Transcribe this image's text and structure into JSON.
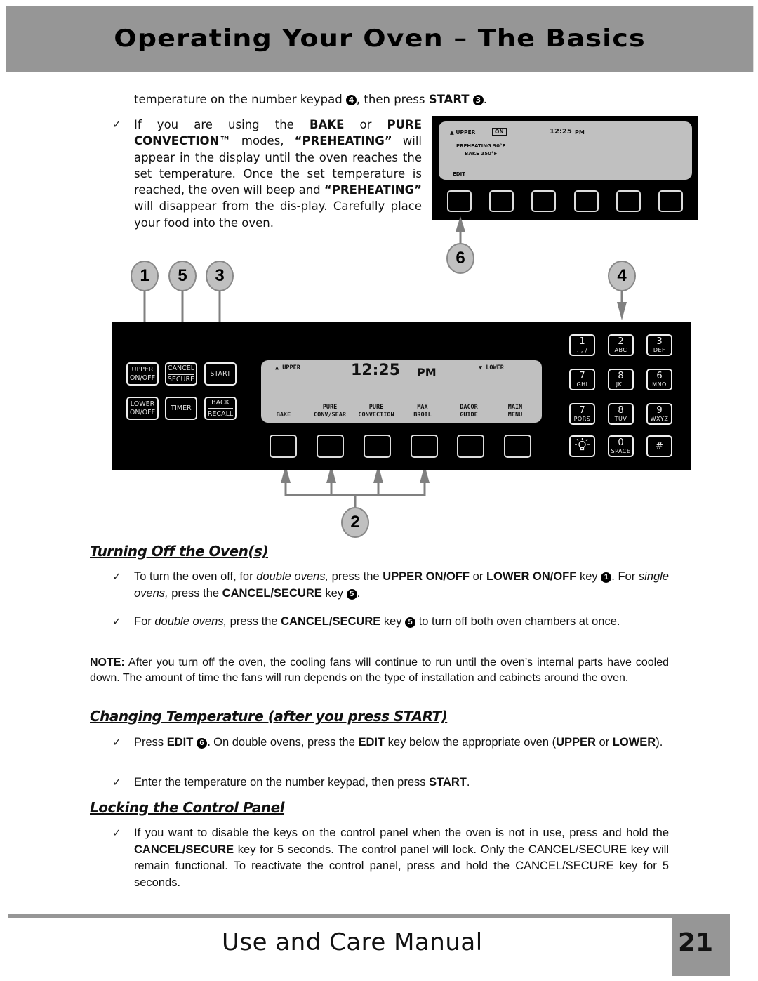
{
  "header": {
    "title": "Operating Your Oven – The Basics"
  },
  "intro": {
    "top_line_pre": "temperature on the number keypad ",
    "top_line_ref1": "4",
    "top_line_mid": ", then press ",
    "top_line_bold": "START",
    "top_line_ref2": "3",
    "top_line_end": ".",
    "bullet_parts": [
      {
        "t": "If you are using the ",
        "b": false
      },
      {
        "t": "BAKE",
        "b": true
      },
      {
        "t": " or ",
        "b": false
      },
      {
        "t": "PURE CONVECTION™",
        "b": true
      },
      {
        "t": " modes, ",
        "b": false
      },
      {
        "t": "“PREHEATING”",
        "b": true
      },
      {
        "t": " will appear in the display until the oven reaches the set temperature. Once the set temperature is reached, the oven will beep and ",
        "b": false
      },
      {
        "t": "“PREHEATING”",
        "b": true
      },
      {
        "t": " will disappear from the dis-play. Carefully place your food into the oven.",
        "b": false
      }
    ]
  },
  "check_glyph": "✓",
  "small_display": {
    "upper_label": "▲ UPPER",
    "on_badge": "ON",
    "time": "12:25",
    "ampm": "PM",
    "line1": "PREHEATING 90°F",
    "line2": "BAKE 350°F",
    "edit_label": "EDIT"
  },
  "callouts": [
    "1",
    "5",
    "3",
    "6",
    "4",
    "2"
  ],
  "panel": {
    "control_keys": [
      {
        "top": "UPPER",
        "bottom": "ON/OFF",
        "sep": false
      },
      {
        "top": "CANCEL",
        "bottom": "SECURE",
        "sep": true
      },
      {
        "top": "START",
        "bottom": "",
        "sep": false
      },
      {
        "top": "LOWER",
        "bottom": "ON/OFF",
        "sep": false
      },
      {
        "top": "TIMER",
        "bottom": "",
        "sep": false
      },
      {
        "top": "BACK",
        "bottom": "RECALL",
        "sep": true
      }
    ],
    "lcd": {
      "upper_label": "▲ UPPER",
      "lower_label": "▼ LOWER",
      "time": "12:25",
      "ampm": "PM",
      "modes": [
        {
          "l1": "",
          "l2": "BAKE"
        },
        {
          "l1": "PURE",
          "l2": "CONV/SEAR"
        },
        {
          "l1": "PURE",
          "l2": "CONVECTION"
        },
        {
          "l1": "MAX",
          "l2": "BROIL"
        },
        {
          "l1": "DACOR",
          "l2": "GUIDE"
        },
        {
          "l1": "MAIN",
          "l2": "MENU"
        }
      ]
    },
    "keypad": [
      {
        "d": "1",
        "l": ". , /"
      },
      {
        "d": "2",
        "l": "ABC"
      },
      {
        "d": "3",
        "l": "DEF"
      },
      {
        "d": "7",
        "l": "GHI"
      },
      {
        "d": "8",
        "l": "JKL"
      },
      {
        "d": "6",
        "l": "MNO"
      },
      {
        "d": "7",
        "l": "PQRS"
      },
      {
        "d": "8",
        "l": "TUV"
      },
      {
        "d": "9",
        "l": "WXYZ"
      },
      {
        "d": "",
        "l": "",
        "icon": "light-bulb-icon"
      },
      {
        "d": "0",
        "l": "SPACE"
      },
      {
        "d": "#",
        "l": ""
      }
    ]
  },
  "sections": {
    "turning_off": {
      "heading": "Turning Off the Oven(s)",
      "bullet1_parts": [
        {
          "t": "To turn the oven off, for ",
          "s": "n"
        },
        {
          "t": "double ovens,",
          "s": "i"
        },
        {
          "t": " press the ",
          "s": "n"
        },
        {
          "t": "UPPER ON/OFF",
          "s": "b"
        },
        {
          "t": " or ",
          "s": "n"
        },
        {
          "t": "LOWER ON/OFF",
          "s": "b"
        },
        {
          "t": " key ",
          "s": "n"
        },
        {
          "t": "1",
          "s": "c"
        },
        {
          "t": ". For ",
          "s": "n"
        },
        {
          "t": "single ovens,",
          "s": "i"
        },
        {
          "t": " press the ",
          "s": "n"
        },
        {
          "t": "CANCEL/SECURE",
          "s": "b"
        },
        {
          "t": " key ",
          "s": "n"
        },
        {
          "t": "5",
          "s": "c"
        },
        {
          "t": ".",
          "s": "n"
        }
      ],
      "bullet2_parts": [
        {
          "t": "For ",
          "s": "n"
        },
        {
          "t": "double ovens,",
          "s": "i"
        },
        {
          "t": " press the ",
          "s": "n"
        },
        {
          "t": "CANCEL/SECURE",
          "s": "b"
        },
        {
          "t": " key ",
          "s": "n"
        },
        {
          "t": "5",
          "s": "c"
        },
        {
          "t": " to turn off both oven chambers at once.",
          "s": "n"
        }
      ],
      "note_label": "NOTE:",
      "note_text": " After you turn off the oven, the cooling fans will continue to run until the oven’s internal parts have cooled down. The amount of time the fans will run depends on the type of installation and cabinets around the oven."
    },
    "changing_temp": {
      "heading": "Changing Temperature (after you press START)",
      "bullet1_parts": [
        {
          "t": "Press ",
          "s": "n"
        },
        {
          "t": "EDIT ",
          "s": "b"
        },
        {
          "t": "6",
          "s": "c"
        },
        {
          "t": ".",
          "s": "b"
        },
        {
          "t": " On double ovens, press the ",
          "s": "n"
        },
        {
          "t": "EDIT",
          "s": "b"
        },
        {
          "t": " key below the appropriate oven (",
          "s": "n"
        },
        {
          "t": "UPPER",
          "s": "b"
        },
        {
          "t": " or ",
          "s": "n"
        },
        {
          "t": "LOWER",
          "s": "b"
        },
        {
          "t": ").",
          "s": "n"
        }
      ],
      "bullet2_parts": [
        {
          "t": "Enter the temperature on the number keypad, then press ",
          "s": "n"
        },
        {
          "t": "START",
          "s": "b"
        },
        {
          "t": ".",
          "s": "n"
        }
      ]
    },
    "locking": {
      "heading": "Locking the Control Panel",
      "bullet1_parts": [
        {
          "t": "If you want to disable the keys on the control panel when the oven is not in use, press and hold the ",
          "s": "n"
        },
        {
          "t": "CANCEL/SECURE",
          "s": "b"
        },
        {
          "t": " key for 5 seconds. The control panel will lock. Only the CANCEL/SECURE key will remain functional. To reactivate the control panel, press and hold the CANCEL/SECURE key for 5 seconds.",
          "s": "n"
        }
      ]
    }
  },
  "footer": {
    "title": "Use and Care Manual",
    "page_number": "21"
  }
}
